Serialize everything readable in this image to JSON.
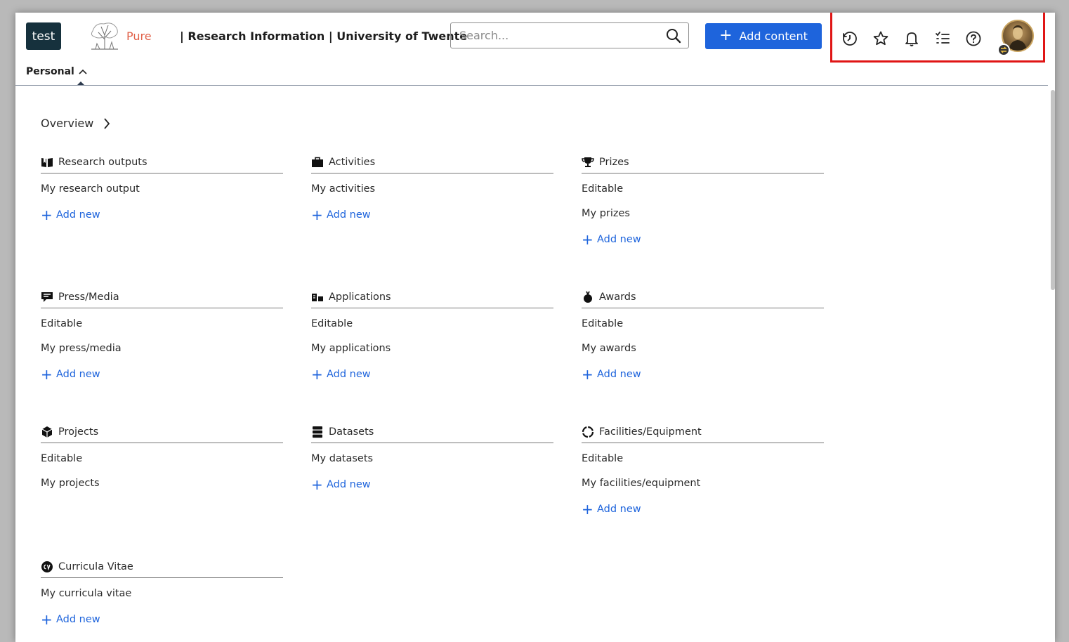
{
  "header": {
    "logo_text": "test",
    "pure_text": "Pure",
    "site_title": "| Research Information | University of Twente",
    "search_placeholder": "Search...",
    "add_content_label": "Add content",
    "icons": [
      "history-icon",
      "star-icon",
      "bell-icon",
      "task-list-icon",
      "help-icon"
    ],
    "accent_color": "#1e64dc",
    "highlight_color": "#e01515"
  },
  "nav": {
    "personal_label": "Personal"
  },
  "overview": {
    "label": "Overview"
  },
  "sections": [
    {
      "title": "Research outputs",
      "icon": "book-icon",
      "items": [
        "My research output"
      ],
      "add_label": "Add new"
    },
    {
      "title": "Activities",
      "icon": "briefcase-icon",
      "items": [
        "My activities"
      ],
      "add_label": "Add new"
    },
    {
      "title": "Prizes",
      "icon": "trophy-icon",
      "items": [
        "Editable",
        "My prizes"
      ],
      "add_label": "Add new"
    },
    {
      "title": "Press/Media",
      "icon": "press-icon",
      "items": [
        "Editable",
        "My press/media"
      ],
      "add_label": "Add new"
    },
    {
      "title": "Applications",
      "icon": "applications-icon",
      "items": [
        "Editable",
        "My applications"
      ],
      "add_label": "Add new"
    },
    {
      "title": "Awards",
      "icon": "award-icon",
      "items": [
        "Editable",
        "My awards"
      ],
      "add_label": "Add new"
    },
    {
      "title": "Projects",
      "icon": "cube-icon",
      "items": [
        "Editable",
        "My projects"
      ],
      "add_label": ""
    },
    {
      "title": "Datasets",
      "icon": "database-icon",
      "items": [
        "My datasets"
      ],
      "add_label": "Add new"
    },
    {
      "title": "Facilities/Equipment",
      "icon": "equipment-icon",
      "items": [
        "Editable",
        "My facilities/equipment"
      ],
      "add_label": "Add new"
    },
    {
      "title": "Curricula Vitae",
      "icon": "cv-icon",
      "items": [
        "My curricula vitae"
      ],
      "add_label": "Add new"
    }
  ]
}
